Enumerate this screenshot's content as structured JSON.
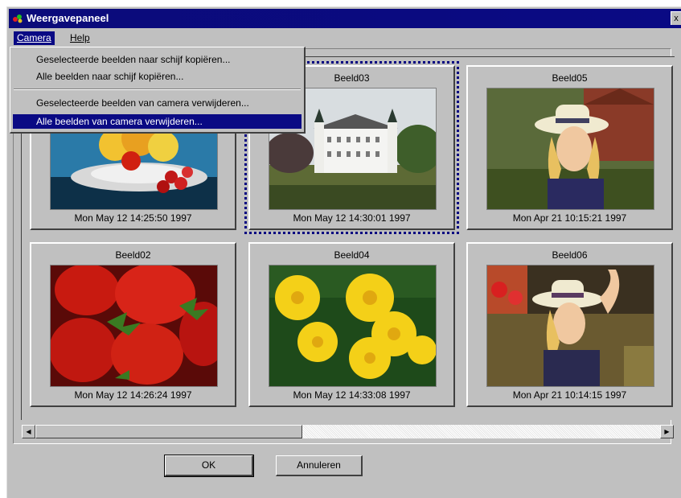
{
  "window": {
    "title": "Weergavepaneel",
    "close_glyph": "x"
  },
  "menu": [
    {
      "label": "Camera",
      "active": true
    },
    {
      "label": "Help",
      "active": false
    }
  ],
  "dropdown": {
    "items": [
      "Geselecteerde beelden naar schijf kopiëren...",
      "Alle beelden naar schijf kopiëren...",
      "Geselecteerde beelden van camera verwijderen...",
      "Alle beelden van camera verwijderen..."
    ],
    "highlighted_index": 3
  },
  "tiles": [
    {
      "name": "",
      "date": "Mon May 12 14:25:50 1997",
      "selected": false,
      "image": "fruit bowl"
    },
    {
      "name": "Beeld03",
      "date": "Mon May 12 14:30:01 1997",
      "selected": true,
      "image": "white castle"
    },
    {
      "name": "Beeld05",
      "date": "Mon Apr 21 10:15:21 1997",
      "selected": false,
      "image": "woman in hat"
    },
    {
      "name": "Beeld02",
      "date": "Mon May 12 14:26:24 1997",
      "selected": false,
      "image": "strawberries"
    },
    {
      "name": "Beeld04",
      "date": "Mon May 12 14:33:08 1997",
      "selected": false,
      "image": "yellow flowers"
    },
    {
      "name": "Beeld06",
      "date": "Mon Apr 21 10:14:15 1997",
      "selected": false,
      "image": "woman in hat arm raised"
    }
  ],
  "scrollbar": {
    "left_arrow": "◀",
    "right_arrow": "▶"
  },
  "buttons": {
    "ok": "OK",
    "cancel": "Annuleren"
  },
  "colors": {
    "titlebar": "#0a0a84",
    "face": "#c0c0c0",
    "highlight": "#0a0a84"
  }
}
